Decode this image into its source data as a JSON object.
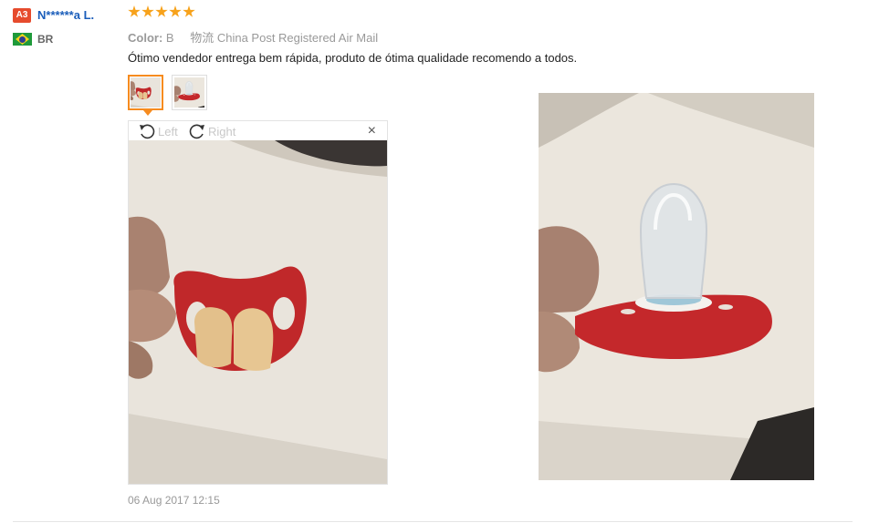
{
  "reviewer": {
    "level_badge": "A3",
    "name": "N******a L.",
    "country_code": "BR",
    "flag_icon": "brazil-flag-icon"
  },
  "review": {
    "rating": 5,
    "star_icon": "star-icon",
    "star_color": "#f7a21b",
    "color_label": "Color:",
    "color_value": "B",
    "logistics_label": "物流",
    "logistics_value": "China Post Registered Air Mail",
    "text": "Ótimo vendedor entrega bem rápida, produto de ótima qualidade recomendo a todos.",
    "date": "06 Aug 2017 12:15"
  },
  "viewer": {
    "rotate_left_label": "Left",
    "rotate_right_label": "Right",
    "close_symbol": "×",
    "rotate_left_icon": "rotate-left-icon",
    "rotate_right_icon": "rotate-right-icon"
  },
  "theme": {
    "accent": "#f68b1f",
    "link": "#1a5dba",
    "badge": "#e64b2d"
  }
}
